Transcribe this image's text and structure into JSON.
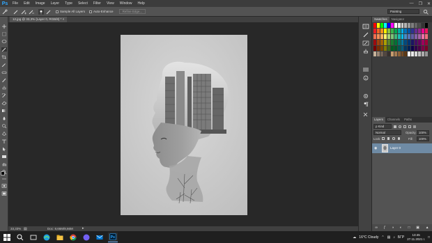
{
  "app": {
    "logo": "Ps"
  },
  "menu": [
    "File",
    "Edit",
    "Image",
    "Layer",
    "Type",
    "Select",
    "Filter",
    "View",
    "Window",
    "Help"
  ],
  "window_controls": {
    "minimize": "—",
    "restore": "❐",
    "close": "✕"
  },
  "options": {
    "sample_all_layers": "Sample All Layers",
    "auto_enhance": "Auto-Enhance",
    "refine_edge": "Refine Edge...",
    "workspace": "Painting"
  },
  "document": {
    "tab_title": "12.jpg @ 33,3% (Layer 0, RGB/8) * ×"
  },
  "status": {
    "zoom": "33,33%",
    "doc_size": "Doc: 8,66M/8,66M"
  },
  "panels": {
    "swatches_tabs": [
      "Swatches",
      "Navigator"
    ],
    "layers_tabs": [
      "Layers",
      "Channels",
      "Paths"
    ],
    "kind_filter": "ρ Kind",
    "blend_mode": "Normal",
    "opacity_label": "Opacity:",
    "opacity_value": "100%",
    "lock_label": "Lock:",
    "fill_label": "Fill:",
    "fill_value": "100%",
    "layer_name": "Layer 0"
  },
  "swatch_colors": [
    "#ff0000",
    "#ffff00",
    "#00ff00",
    "#00ffff",
    "#0000ff",
    "#ff00ff",
    "#ffffff",
    "#e6e6e6",
    "#cccccc",
    "#b3b3b3",
    "#999999",
    "#808080",
    "#666666",
    "#4d4d4d",
    "#333333",
    "#000000",
    "#ed1c24",
    "#f26522",
    "#f7941d",
    "#fff200",
    "#8dc63f",
    "#39b54a",
    "#00a651",
    "#00a99d",
    "#00aeef",
    "#0072bc",
    "#0054a6",
    "#2e3192",
    "#662d91",
    "#92278f",
    "#ec008c",
    "#ed145b",
    "#f26c4f",
    "#f68e56",
    "#fbaf5d",
    "#fff568",
    "#acd373",
    "#7cc576",
    "#3cb878",
    "#1abbb4",
    "#00bff3",
    "#448ccb",
    "#5674b9",
    "#605ca8",
    "#855fa8",
    "#a763a8",
    "#f06eaa",
    "#f26d7d",
    "#9e0b0f",
    "#a0410d",
    "#a36209",
    "#aba000",
    "#598527",
    "#197b30",
    "#007236",
    "#00746b",
    "#0076a3",
    "#004a80",
    "#003471",
    "#1b1464",
    "#440e62",
    "#630460",
    "#9e005d",
    "#9e0039",
    "#790000",
    "#7b2e00",
    "#7d4900",
    "#827b00",
    "#406618",
    "#005e20",
    "#005826",
    "#005952",
    "#005b7f",
    "#003663",
    "#002157",
    "#0d004c",
    "#32004b",
    "#4b0049",
    "#7b0046",
    "#7a0026",
    "#c7b299",
    "#998675",
    "#736357",
    "#534741",
    "#37302d",
    "#c69c6d",
    "#a67c52",
    "#8c6239",
    "#754c24",
    "#603913",
    "#ffffff",
    "#ebebeb",
    "#d7d7d7",
    "#c2c2c2",
    "#acacac",
    "#959595"
  ],
  "taskbar": {
    "weather": "16°C  Cloudy",
    "language": "БГР",
    "time": "13:45",
    "date": "27.11.2021 г."
  }
}
